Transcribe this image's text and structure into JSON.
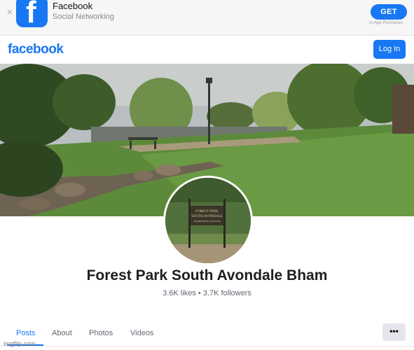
{
  "banner": {
    "app_name": "Facebook",
    "app_category": "Social Networking",
    "get_label": "GET",
    "in_app_label": "In-App Purchases",
    "close_glyph": "×",
    "icon_glyph": "f"
  },
  "header": {
    "logo": "facebook",
    "login_label": "Log In"
  },
  "page": {
    "name": "Forest Park South Avondale Bham",
    "stats": "3.6K likes • 3.7K followers"
  },
  "avatar": {
    "sign_line1": "FOREST PARK",
    "sign_line2": "SOUTH AVONDALE",
    "sign_line3": "NEIGHBORHOOD ASSOCIATION"
  },
  "tabs": [
    {
      "label": "Posts"
    },
    {
      "label": "About"
    },
    {
      "label": "Photos"
    },
    {
      "label": "Videos"
    }
  ],
  "more_label": "•••",
  "watermark": "imgflip.com",
  "colors": {
    "brand": "#1877f2",
    "text_primary": "#1c1e21",
    "text_secondary": "#606770"
  }
}
